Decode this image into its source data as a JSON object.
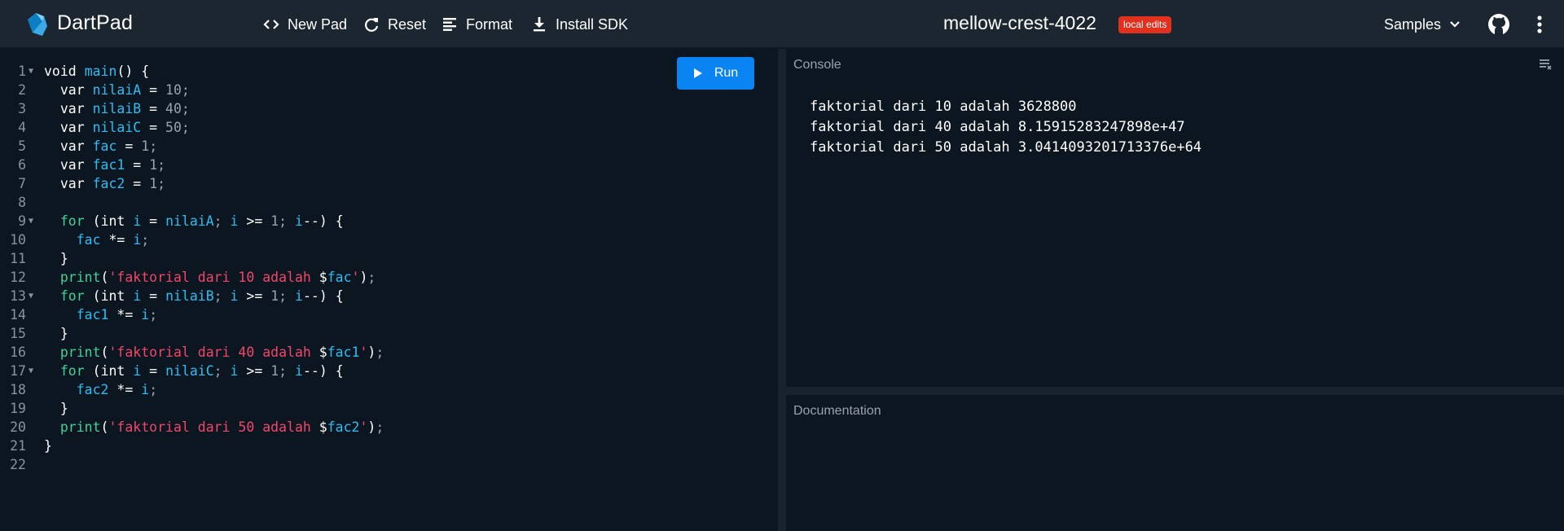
{
  "header": {
    "app_title": "DartPad",
    "buttons": {
      "new_pad": "New Pad",
      "reset": "Reset",
      "format": "Format",
      "install_sdk": "Install SDK"
    },
    "pad_title": "mellow-crest-4022",
    "badge": "local edits",
    "samples": "Samples"
  },
  "editor": {
    "run_label": "Run",
    "line_numbers": [
      "1",
      "2",
      "3",
      "4",
      "5",
      "6",
      "7",
      "8",
      "9",
      "10",
      "11",
      "12",
      "13",
      "14",
      "15",
      "16",
      "17",
      "18",
      "19",
      "20",
      "21",
      "22"
    ],
    "folded_lines": [
      1,
      9,
      13,
      17
    ],
    "code": [
      "void main() {",
      "  var nilaiA = 10;",
      "  var nilaiB = 40;",
      "  var nilaiC = 50;",
      "  var fac = 1;",
      "  var fac1 = 1;",
      "  var fac2 = 1;",
      "",
      "  for (int i = nilaiA; i >= 1; i--) {",
      "    fac *= i;",
      "  }",
      "  print('faktorial dari 10 adalah $fac');",
      "  for (int i = nilaiB; i >= 1; i--) {",
      "    fac1 *= i;",
      "  }",
      "  print('faktorial dari 40 adalah $fac1');",
      "  for (int i = nilaiC; i >= 1; i--) {",
      "    fac2 *= i;",
      "  }",
      "  print('faktorial dari 50 adalah $fac2');",
      "}",
      ""
    ]
  },
  "console": {
    "label": "Console",
    "output": [
      "faktorial dari 10 adalah 3628800",
      "faktorial dari 40 adalah 8.15915283247898e+47",
      "faktorial dari 50 adalah 3.0414093201713376e+64"
    ]
  },
  "documentation": {
    "label": "Documentation"
  },
  "colors": {
    "background": "#0c1620",
    "header": "#1b2630",
    "run_button": "#0a84f2",
    "badge": "#e2301e",
    "keyword": "#3fd29a",
    "identifier": "#2fbcf2",
    "string": "#f2466a",
    "number": "#9aa3ab"
  },
  "icons": {
    "logo": "dart-logo-icon",
    "new_pad": "code-brackets-icon",
    "reset": "refresh-icon",
    "format": "format-lines-icon",
    "install": "download-icon",
    "samples": "chevron-down-icon",
    "github": "github-icon",
    "more": "more-vert-icon",
    "run": "play-icon",
    "clear": "clear-console-icon"
  }
}
